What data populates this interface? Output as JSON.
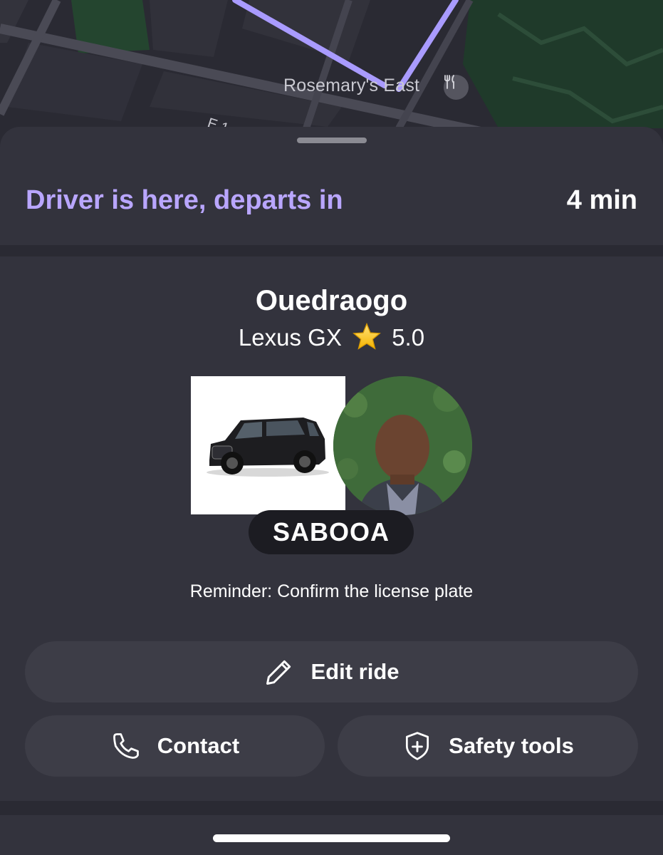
{
  "map": {
    "poi_label": "Rosemary's East",
    "poi_icon": "restaurant-icon",
    "street_label": "E 1"
  },
  "sheet": {
    "status_text": "Driver is here, departs in",
    "eta": "4 min"
  },
  "driver": {
    "name": "Ouedraogo",
    "vehicle": "Lexus GX",
    "rating_icon": "star-icon",
    "rating": "5.0",
    "license_plate": "SABOOA",
    "reminder": "Reminder: Confirm the license plate"
  },
  "actions": {
    "edit_ride": {
      "label": "Edit ride",
      "icon": "pencil-icon"
    },
    "contact": {
      "label": "Contact",
      "icon": "phone-icon"
    },
    "safety_tools": {
      "label": "Safety tools",
      "icon": "shield-plus-icon"
    }
  },
  "colors": {
    "accent": "#b9a6ff",
    "route": "#a99bff",
    "sheet_bg": "#33333d",
    "button_bg": "#3d3d47"
  }
}
